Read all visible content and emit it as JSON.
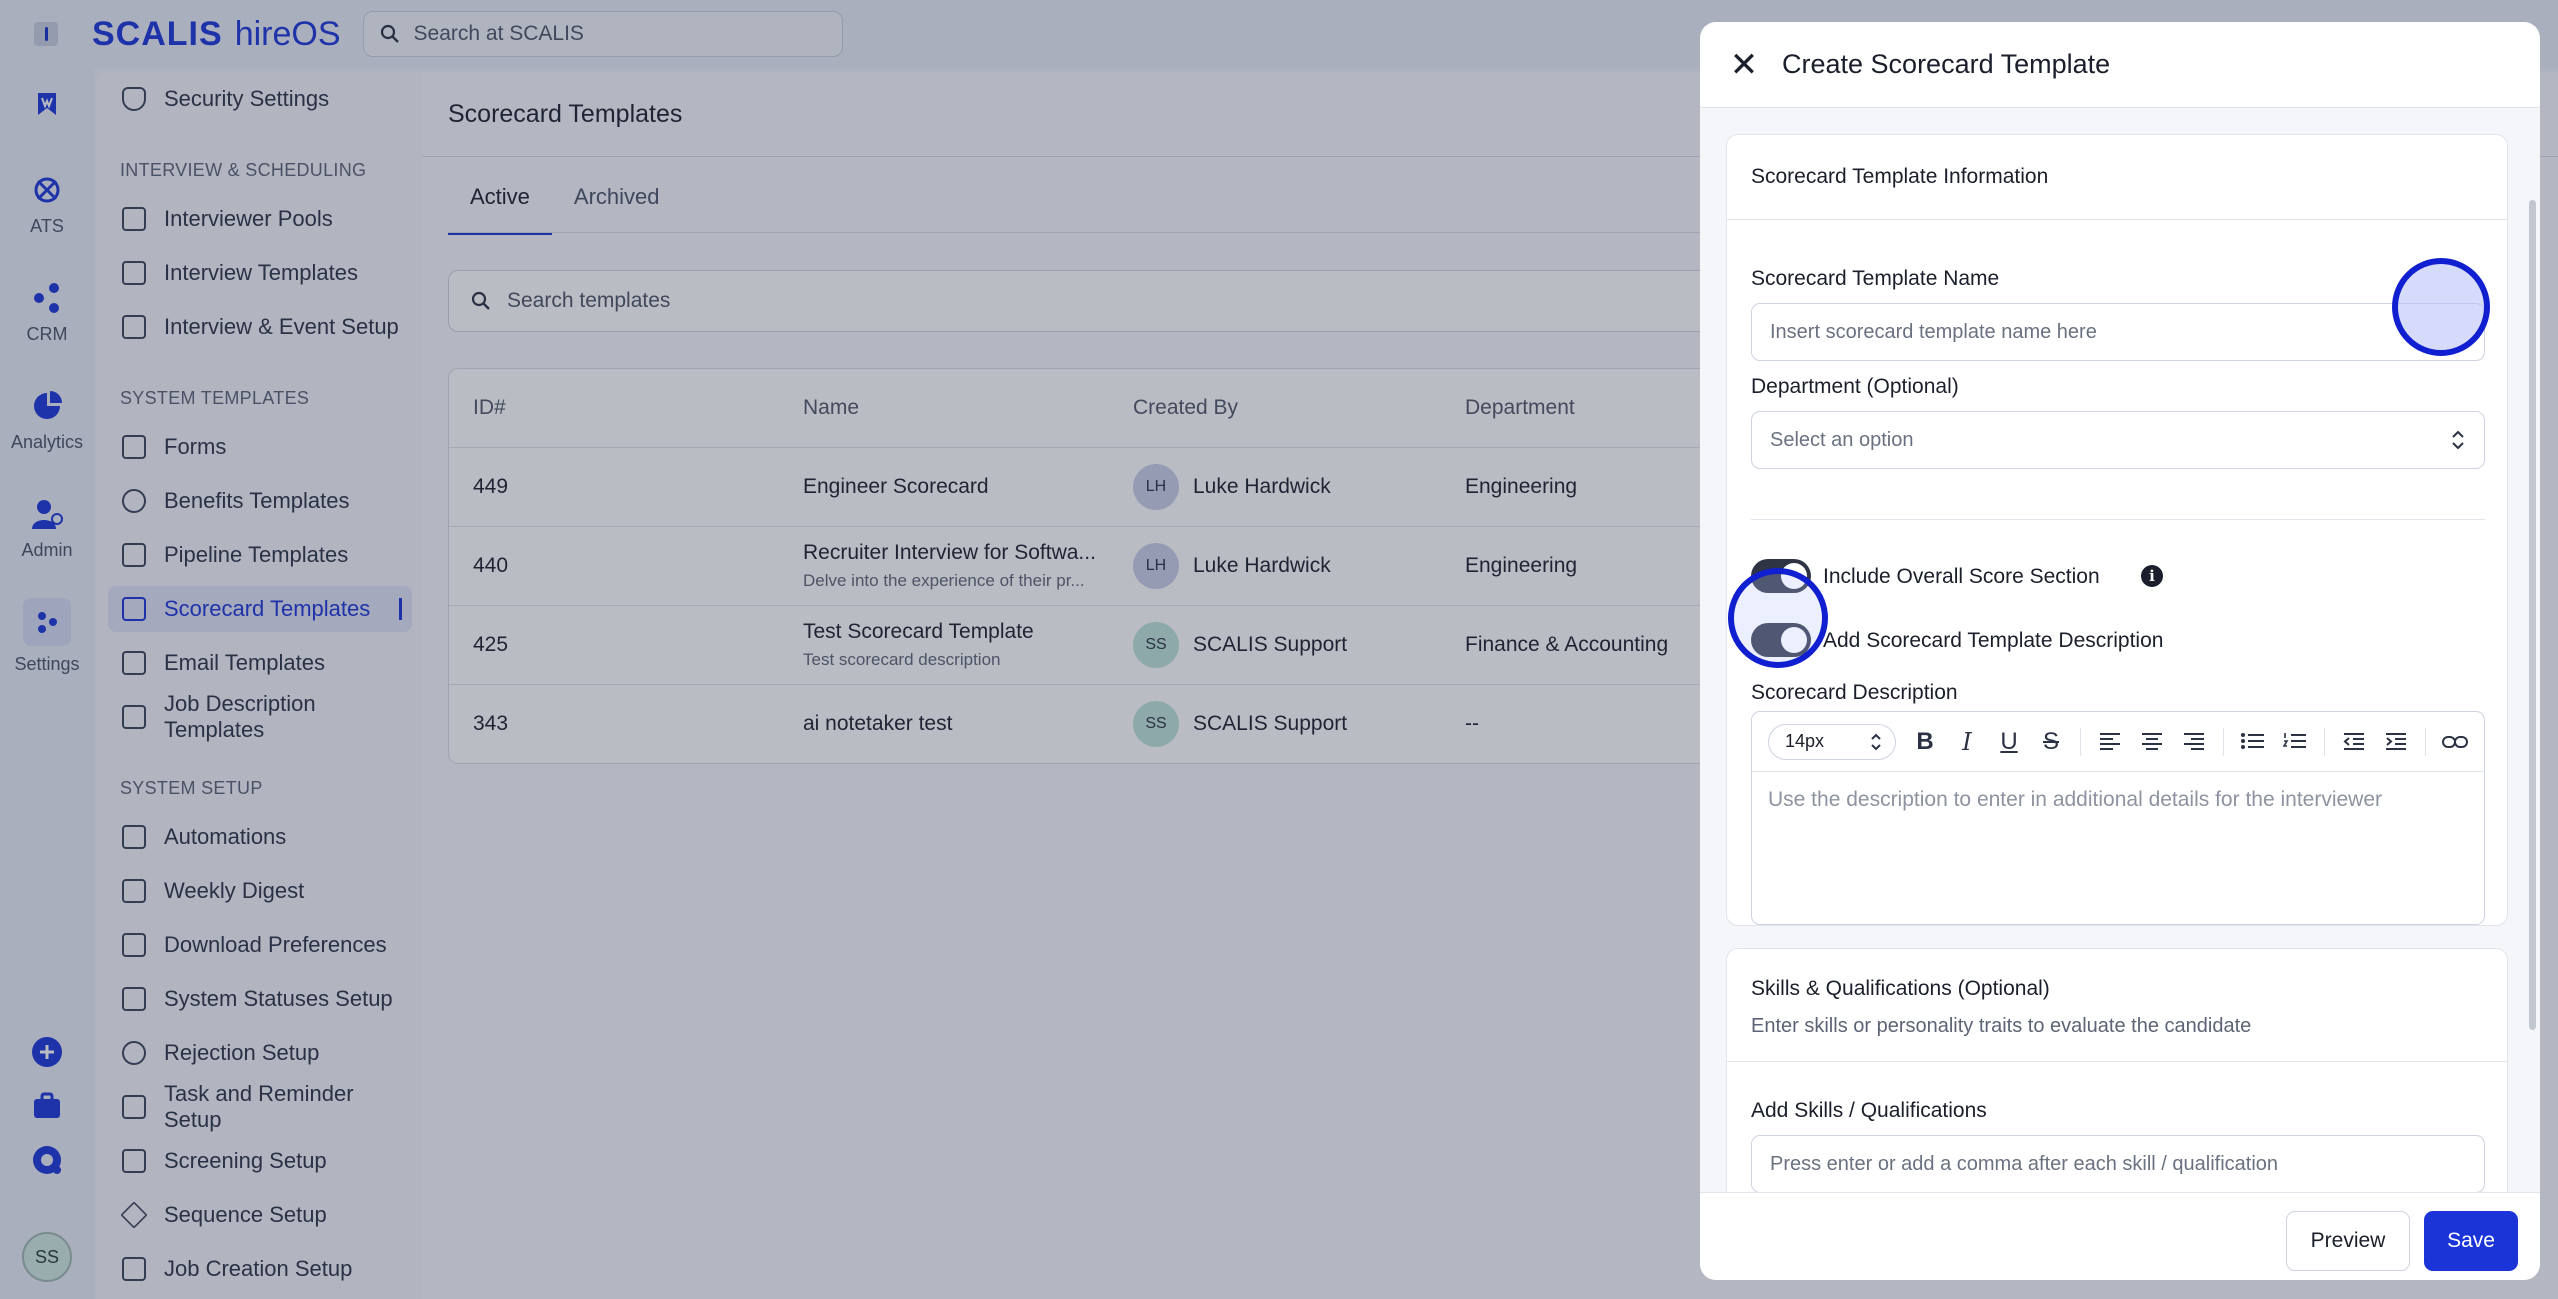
{
  "brand": {
    "logo": "SCALIS",
    "product": "hireOS"
  },
  "top_search": {
    "placeholder": "Search at SCALIS"
  },
  "rail": {
    "items": [
      {
        "label": "",
        "icon": "bookmark-icon"
      },
      {
        "label": "ATS",
        "icon": "ats-icon"
      },
      {
        "label": "CRM",
        "icon": "crm-icon"
      },
      {
        "label": "Analytics",
        "icon": "analytics-icon"
      },
      {
        "label": "Admin",
        "icon": "admin-icon"
      },
      {
        "label": "Settings",
        "icon": "settings-icon"
      }
    ],
    "avatar": "SS"
  },
  "sidebar": {
    "items": [
      {
        "label": "Security Settings",
        "icon": "shield-icon"
      },
      {
        "group": "INTERVIEW & SCHEDULING"
      },
      {
        "label": "Interviewer Pools",
        "icon": "calendar-icon"
      },
      {
        "label": "Interview Templates",
        "icon": "calendar-clock-icon"
      },
      {
        "label": "Interview & Event Setup",
        "icon": "calendar-icon"
      },
      {
        "group": "SYSTEM TEMPLATES"
      },
      {
        "label": "Forms",
        "icon": "form-icon"
      },
      {
        "label": "Benefits Templates",
        "icon": "badge-check-icon"
      },
      {
        "label": "Pipeline Templates",
        "icon": "pipeline-icon"
      },
      {
        "label": "Scorecard Templates",
        "icon": "clipboard-icon",
        "active": true
      },
      {
        "label": "Email Templates",
        "icon": "chat-icon"
      },
      {
        "label": "Job Description Templates",
        "icon": "document-icon"
      },
      {
        "group": "SYSTEM SETUP"
      },
      {
        "label": "Automations",
        "icon": "automation-icon"
      },
      {
        "label": "Weekly Digest",
        "icon": "newspaper-icon"
      },
      {
        "label": "Download Preferences",
        "icon": "download-file-icon"
      },
      {
        "label": "System Statuses Setup",
        "icon": "workflow-icon"
      },
      {
        "label": "Rejection Setup",
        "icon": "user-x-icon"
      },
      {
        "label": "Task and Reminder Setup",
        "icon": "clipboard-list-icon"
      },
      {
        "label": "Screening Setup",
        "icon": "clipboard-check-icon"
      },
      {
        "label": "Sequence Setup",
        "icon": "send-icon"
      },
      {
        "label": "Job Creation Setup",
        "icon": "camera-icon"
      }
    ]
  },
  "main": {
    "title": "Scorecard Templates",
    "tabs": [
      "Active",
      "Archived"
    ],
    "search_placeholder": "Search templates",
    "table": {
      "columns": [
        "ID#",
        "Name",
        "Created By",
        "Department"
      ],
      "rows": [
        {
          "id": "449",
          "name": "Engineer Scorecard",
          "desc": "",
          "initials": "LH",
          "creator": "Luke Hardwick",
          "department": "Engineering"
        },
        {
          "id": "440",
          "name": "Recruiter Interview for Softwa...",
          "desc": "Delve into the experience of their pr...",
          "initials": "LH",
          "creator": "Luke Hardwick",
          "department": "Engineering"
        },
        {
          "id": "425",
          "name": "Test Scorecard Template",
          "desc": "Test scorecard description",
          "initials": "SS",
          "creator": "SCALIS Support",
          "department": "Finance & Accounting"
        },
        {
          "id": "343",
          "name": "ai notetaker test",
          "desc": "",
          "initials": "SS",
          "creator": "SCALIS Support",
          "department": "--"
        }
      ]
    }
  },
  "modal": {
    "title": "Create Scorecard Template",
    "info_section": {
      "title": "Scorecard Template Information",
      "name_label": "Scorecard Template Name",
      "name_placeholder": "Insert scorecard template name here",
      "dept_label": "Department (Optional)",
      "dept_placeholder": "Select an option",
      "toggle_overall": "Include Overall Score Section",
      "toggle_description": "Add Scorecard Template Description",
      "desc_label": "Scorecard Description",
      "font_size": "14px",
      "desc_placeholder": "Use the description to enter in additional details for the interviewer"
    },
    "skills_section": {
      "title": "Skills & Qualifications (Optional)",
      "subtitle": "Enter skills or personality traits to evaluate the candidate",
      "add_label": "Add Skills / Qualifications",
      "add_placeholder": "Press enter or add a comma after each skill / qualification"
    },
    "buttons": {
      "preview": "Preview",
      "save": "Save"
    }
  },
  "colors": {
    "accent": "#1a34d8",
    "toggle_on": "#2f3445"
  }
}
